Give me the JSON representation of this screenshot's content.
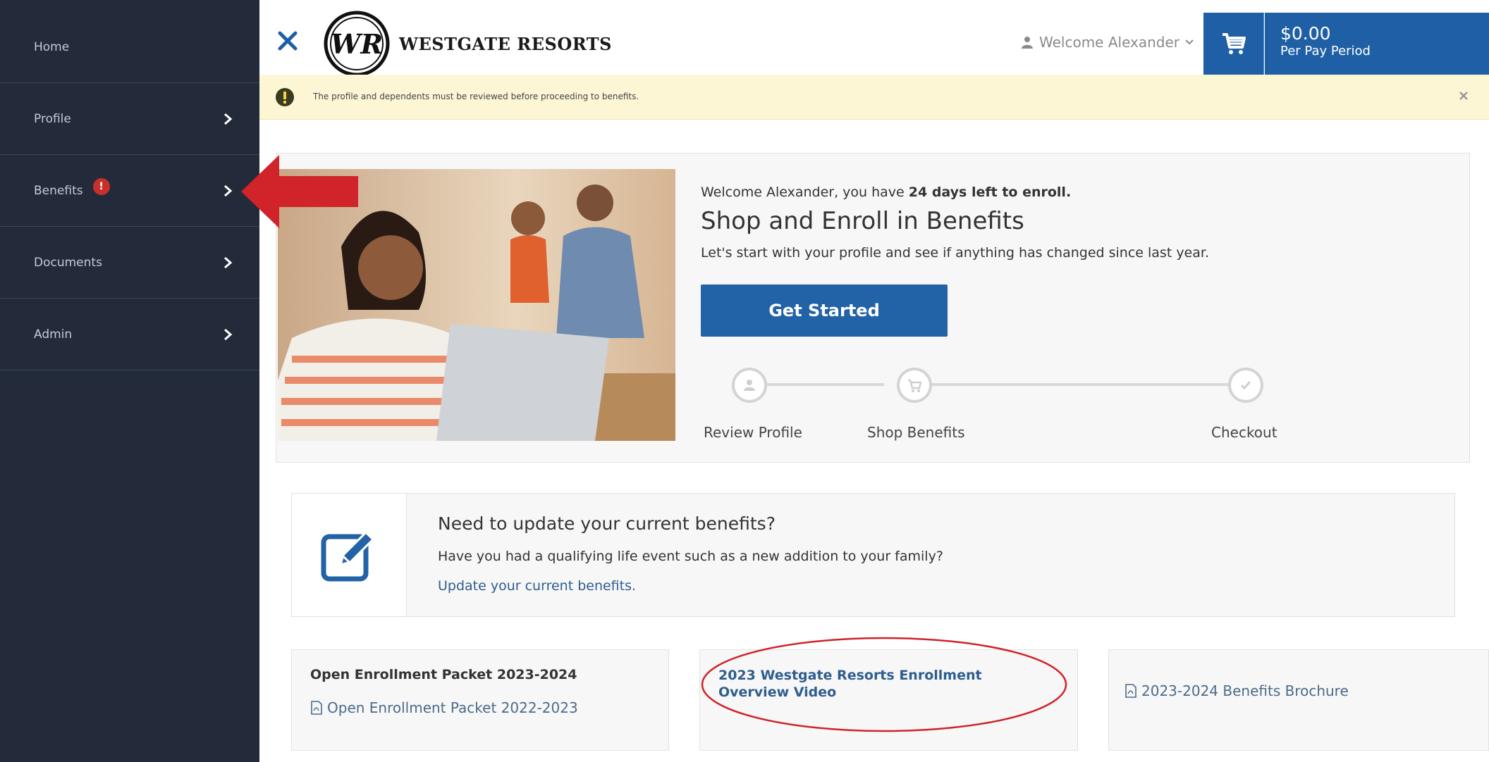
{
  "sidebar": {
    "items": [
      {
        "label": "Home"
      },
      {
        "label": "Profile"
      },
      {
        "label": "Benefits",
        "badge": "!"
      },
      {
        "label": "Documents"
      },
      {
        "label": "Admin"
      }
    ]
  },
  "header": {
    "logo_text": "WESTGATE RESORTS",
    "logo_monogram": "WR",
    "welcome": "Welcome Alexander",
    "price": "$0.00",
    "price_sub": "Per Pay Period"
  },
  "alert": {
    "text": "The profile and dependents must be reviewed before proceeding to benefits."
  },
  "hero": {
    "welcome_prefix": "Welcome Alexander, you have ",
    "welcome_bold": "24 days left to enroll.",
    "title": "Shop and Enroll in Benefits",
    "subtitle": "Let's start with your profile and see if anything has changed since last year.",
    "button": "Get Started",
    "steps": [
      {
        "label": "Review Profile",
        "icon": "user-icon"
      },
      {
        "label": "Shop Benefits",
        "icon": "cart-icon"
      },
      {
        "label": "Checkout",
        "icon": "check-icon"
      }
    ]
  },
  "update": {
    "title": "Need to update your current benefits?",
    "description": "Have you had a qualifying life event such as a new addition to your family?",
    "link": "Update your current benefits."
  },
  "cards": {
    "packet_title": "Open Enrollment Packet 2023-2024",
    "packet_link": "Open Enrollment Packet 2022-2023",
    "video_title": "2023 Westgate Resorts Enrollment Overview Video",
    "brochure_link": "2023-2024 Benefits Brochure"
  },
  "colors": {
    "sidebar_bg": "#232b3a",
    "primary_blue": "#1f5fa5",
    "alert_bg": "#fcf6d5",
    "badge_red": "#c9302c",
    "annotation_red": "#d0232a"
  }
}
